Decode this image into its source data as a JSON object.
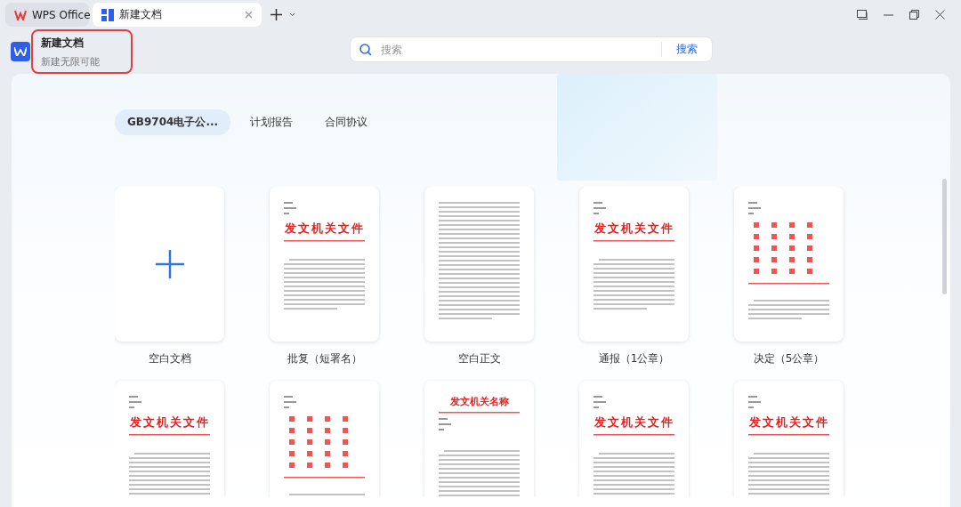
{
  "tabs": [
    {
      "label": "WPS Office",
      "kind": "home",
      "selected": false
    },
    {
      "label": "新建文档",
      "kind": "doc",
      "selected": true
    }
  ],
  "header": {
    "title": "新建文档",
    "subtitle": "新建无限可能",
    "highlighted": true
  },
  "search": {
    "placeholder": "搜索",
    "button": "搜索"
  },
  "categories": [
    {
      "label": "GB9704电子公...",
      "selected": true
    },
    {
      "label": "计划报告",
      "selected": false
    },
    {
      "label": "合同协议",
      "selected": false
    }
  ],
  "templates": [
    {
      "kind": "blank",
      "label": "空白文档"
    },
    {
      "kind": "letterhead",
      "heading": "发文机关文件",
      "label": "批复（短署名）"
    },
    {
      "kind": "plain",
      "label": "空白正文"
    },
    {
      "kind": "letterhead",
      "heading": "发文机关文件",
      "label": "通报（1公章）"
    },
    {
      "kind": "joint",
      "label": "决定（5公章）"
    },
    {
      "kind": "letterhead",
      "heading": "发文机关文件"
    },
    {
      "kind": "joint"
    },
    {
      "kind": "namebar",
      "heading": "发文机关名称"
    },
    {
      "kind": "letterhead",
      "heading": "发文机关文件"
    },
    {
      "kind": "letterhead",
      "heading": "发文机关文件"
    }
  ]
}
